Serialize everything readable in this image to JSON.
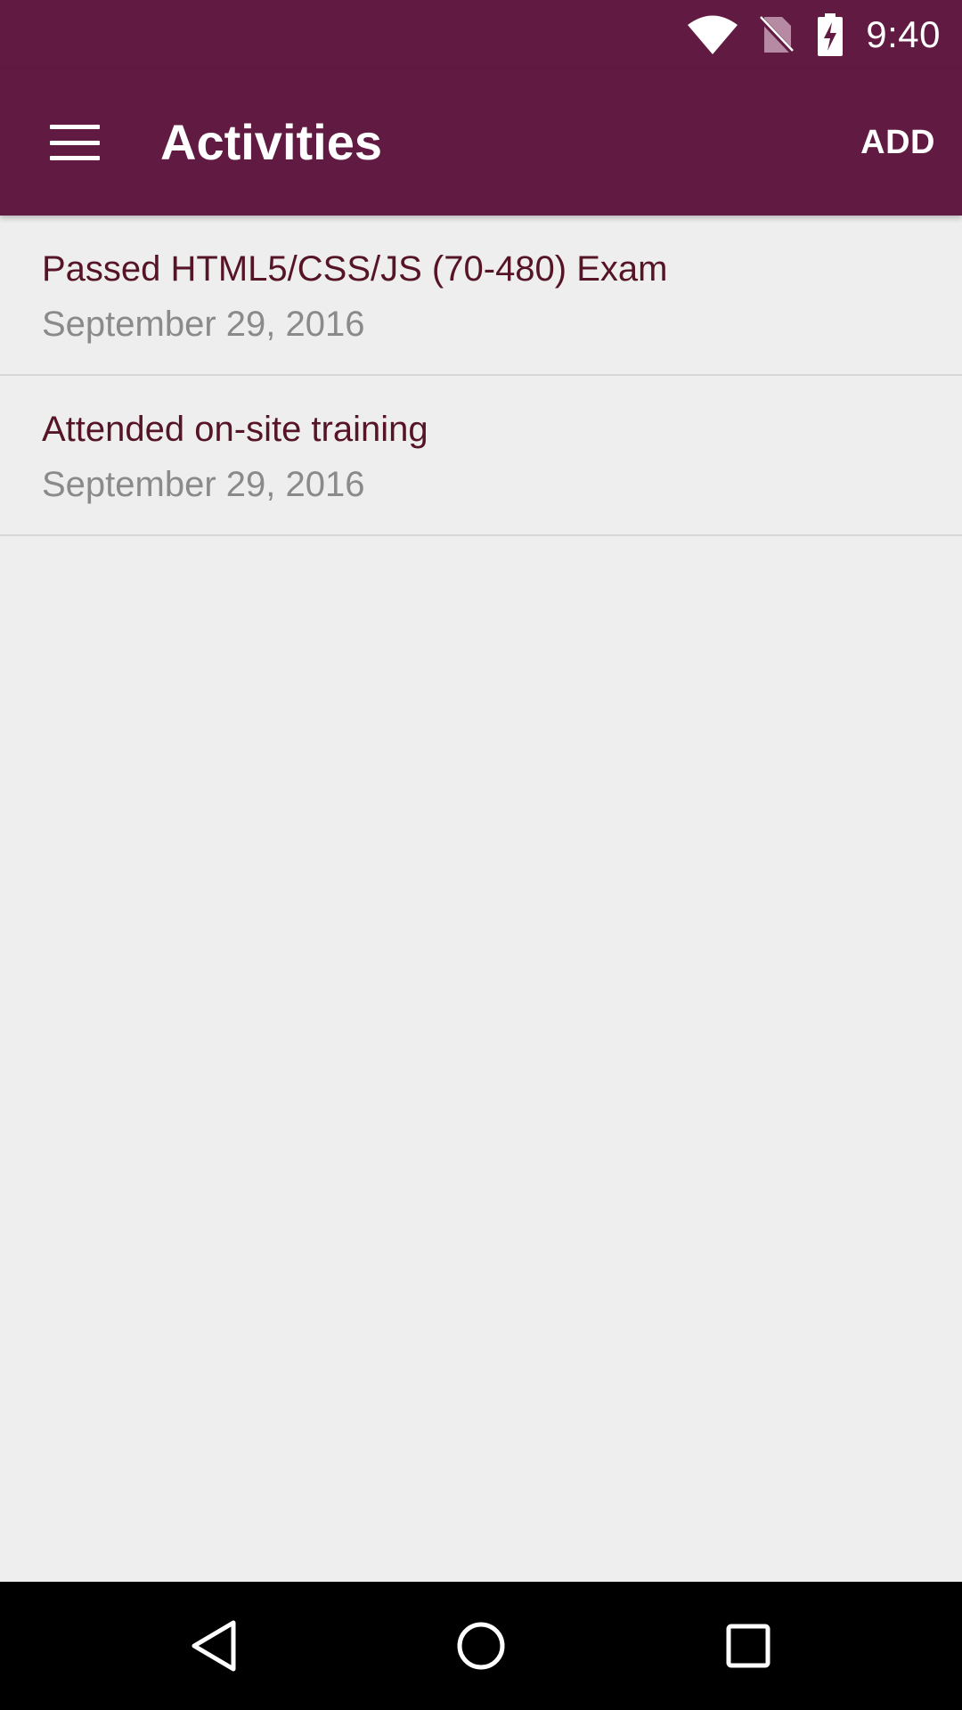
{
  "status_bar": {
    "time": "9:40",
    "icons": [
      "wifi-icon",
      "no-sim-icon",
      "battery-charging-icon"
    ]
  },
  "app_bar": {
    "title": "Activities",
    "menu_icon": "hamburger-menu-icon",
    "add_label": "ADD"
  },
  "activities": [
    {
      "title": "Passed HTML5/CSS/JS (70-480) Exam",
      "date": "September 29, 2016"
    },
    {
      "title": "Attended on-site training",
      "date": "September 29, 2016"
    }
  ],
  "nav_bar": {
    "icons": [
      "back-icon",
      "home-icon",
      "recents-icon"
    ]
  },
  "colors": {
    "primary": "#611a41",
    "item_title": "#561526",
    "item_date": "#8a8a8a",
    "background": "#eeeeee"
  }
}
